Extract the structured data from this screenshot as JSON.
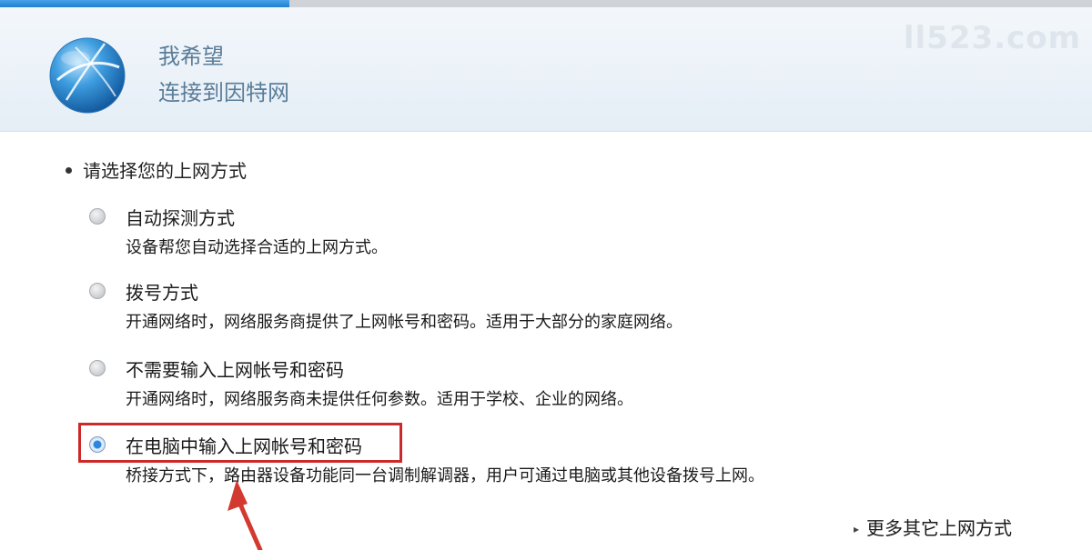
{
  "progress": {
    "percent": 26.5,
    "color": "#2a86e0"
  },
  "header": {
    "line1": "我希望",
    "line2": "连接到因特网",
    "icon": "globe-icon",
    "watermark": "ll523.com"
  },
  "section": {
    "title": "请选择您的上网方式"
  },
  "options": [
    {
      "label": "自动探测方式",
      "desc": "设备帮您自动选择合适的上网方式。",
      "selected": false
    },
    {
      "label": "拨号方式",
      "desc": "开通网络时，网络服务商提供了上网帐号和密码。适用于大部分的家庭网络。",
      "selected": false
    },
    {
      "label": "不需要输入上网帐号和密码",
      "desc": "开通网络时，网络服务商未提供任何参数。适用于学校、企业的网络。",
      "selected": false
    },
    {
      "label": "在电脑中输入上网帐号和密码",
      "desc": "桥接方式下，路由器设备功能同一台调制解调器，用户可通过电脑或其他设备拨号上网。",
      "selected": true
    }
  ],
  "annotation": {
    "box_color": "#cc2a2a",
    "arrow_color": "#d23a2f"
  },
  "more_link": {
    "label": "更多其它上网方式",
    "icon": "chevron-right-icon"
  }
}
